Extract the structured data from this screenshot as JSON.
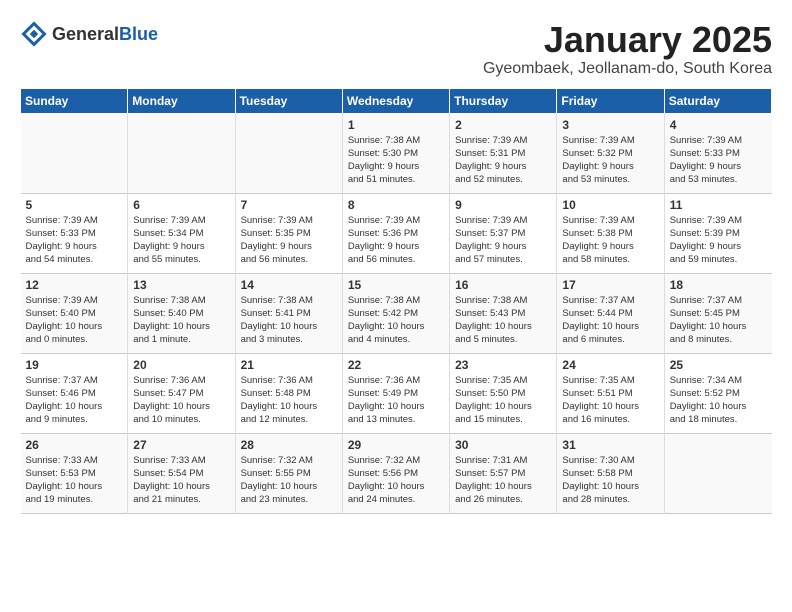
{
  "header": {
    "logo_general": "General",
    "logo_blue": "Blue",
    "title": "January 2025",
    "subtitle": "Gyeombaek, Jeollanam-do, South Korea"
  },
  "days_of_week": [
    "Sunday",
    "Monday",
    "Tuesday",
    "Wednesday",
    "Thursday",
    "Friday",
    "Saturday"
  ],
  "weeks": [
    [
      {
        "day": "",
        "info": ""
      },
      {
        "day": "",
        "info": ""
      },
      {
        "day": "",
        "info": ""
      },
      {
        "day": "1",
        "info": "Sunrise: 7:38 AM\nSunset: 5:30 PM\nDaylight: 9 hours\nand 51 minutes."
      },
      {
        "day": "2",
        "info": "Sunrise: 7:39 AM\nSunset: 5:31 PM\nDaylight: 9 hours\nand 52 minutes."
      },
      {
        "day": "3",
        "info": "Sunrise: 7:39 AM\nSunset: 5:32 PM\nDaylight: 9 hours\nand 53 minutes."
      },
      {
        "day": "4",
        "info": "Sunrise: 7:39 AM\nSunset: 5:33 PM\nDaylight: 9 hours\nand 53 minutes."
      }
    ],
    [
      {
        "day": "5",
        "info": "Sunrise: 7:39 AM\nSunset: 5:33 PM\nDaylight: 9 hours\nand 54 minutes."
      },
      {
        "day": "6",
        "info": "Sunrise: 7:39 AM\nSunset: 5:34 PM\nDaylight: 9 hours\nand 55 minutes."
      },
      {
        "day": "7",
        "info": "Sunrise: 7:39 AM\nSunset: 5:35 PM\nDaylight: 9 hours\nand 56 minutes."
      },
      {
        "day": "8",
        "info": "Sunrise: 7:39 AM\nSunset: 5:36 PM\nDaylight: 9 hours\nand 56 minutes."
      },
      {
        "day": "9",
        "info": "Sunrise: 7:39 AM\nSunset: 5:37 PM\nDaylight: 9 hours\nand 57 minutes."
      },
      {
        "day": "10",
        "info": "Sunrise: 7:39 AM\nSunset: 5:38 PM\nDaylight: 9 hours\nand 58 minutes."
      },
      {
        "day": "11",
        "info": "Sunrise: 7:39 AM\nSunset: 5:39 PM\nDaylight: 9 hours\nand 59 minutes."
      }
    ],
    [
      {
        "day": "12",
        "info": "Sunrise: 7:39 AM\nSunset: 5:40 PM\nDaylight: 10 hours\nand 0 minutes."
      },
      {
        "day": "13",
        "info": "Sunrise: 7:38 AM\nSunset: 5:40 PM\nDaylight: 10 hours\nand 1 minute."
      },
      {
        "day": "14",
        "info": "Sunrise: 7:38 AM\nSunset: 5:41 PM\nDaylight: 10 hours\nand 3 minutes."
      },
      {
        "day": "15",
        "info": "Sunrise: 7:38 AM\nSunset: 5:42 PM\nDaylight: 10 hours\nand 4 minutes."
      },
      {
        "day": "16",
        "info": "Sunrise: 7:38 AM\nSunset: 5:43 PM\nDaylight: 10 hours\nand 5 minutes."
      },
      {
        "day": "17",
        "info": "Sunrise: 7:37 AM\nSunset: 5:44 PM\nDaylight: 10 hours\nand 6 minutes."
      },
      {
        "day": "18",
        "info": "Sunrise: 7:37 AM\nSunset: 5:45 PM\nDaylight: 10 hours\nand 8 minutes."
      }
    ],
    [
      {
        "day": "19",
        "info": "Sunrise: 7:37 AM\nSunset: 5:46 PM\nDaylight: 10 hours\nand 9 minutes."
      },
      {
        "day": "20",
        "info": "Sunrise: 7:36 AM\nSunset: 5:47 PM\nDaylight: 10 hours\nand 10 minutes."
      },
      {
        "day": "21",
        "info": "Sunrise: 7:36 AM\nSunset: 5:48 PM\nDaylight: 10 hours\nand 12 minutes."
      },
      {
        "day": "22",
        "info": "Sunrise: 7:36 AM\nSunset: 5:49 PM\nDaylight: 10 hours\nand 13 minutes."
      },
      {
        "day": "23",
        "info": "Sunrise: 7:35 AM\nSunset: 5:50 PM\nDaylight: 10 hours\nand 15 minutes."
      },
      {
        "day": "24",
        "info": "Sunrise: 7:35 AM\nSunset: 5:51 PM\nDaylight: 10 hours\nand 16 minutes."
      },
      {
        "day": "25",
        "info": "Sunrise: 7:34 AM\nSunset: 5:52 PM\nDaylight: 10 hours\nand 18 minutes."
      }
    ],
    [
      {
        "day": "26",
        "info": "Sunrise: 7:33 AM\nSunset: 5:53 PM\nDaylight: 10 hours\nand 19 minutes."
      },
      {
        "day": "27",
        "info": "Sunrise: 7:33 AM\nSunset: 5:54 PM\nDaylight: 10 hours\nand 21 minutes."
      },
      {
        "day": "28",
        "info": "Sunrise: 7:32 AM\nSunset: 5:55 PM\nDaylight: 10 hours\nand 23 minutes."
      },
      {
        "day": "29",
        "info": "Sunrise: 7:32 AM\nSunset: 5:56 PM\nDaylight: 10 hours\nand 24 minutes."
      },
      {
        "day": "30",
        "info": "Sunrise: 7:31 AM\nSunset: 5:57 PM\nDaylight: 10 hours\nand 26 minutes."
      },
      {
        "day": "31",
        "info": "Sunrise: 7:30 AM\nSunset: 5:58 PM\nDaylight: 10 hours\nand 28 minutes."
      },
      {
        "day": "",
        "info": ""
      }
    ]
  ]
}
